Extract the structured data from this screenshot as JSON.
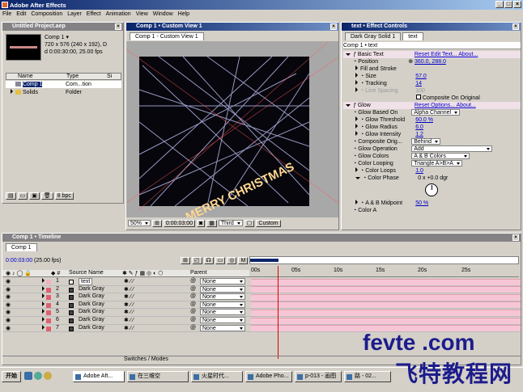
{
  "app": {
    "title": "Adobe After Effects"
  },
  "menu": [
    "File",
    "Edit",
    "Composition",
    "Layer",
    "Effect",
    "Animation",
    "View",
    "Window",
    "Help"
  ],
  "project": {
    "title": "Untitled Project.aep",
    "comp_name": "Comp 1 ▾",
    "info1": "720 x 576  (240 x 192), D",
    "info2": "d 0:00:30:00, 25.00 fps",
    "columns": [
      "Name",
      "Type",
      "Si"
    ],
    "items": [
      {
        "name": "Comp 1",
        "type": "Com...tion"
      },
      {
        "name": "Solids",
        "type": "Folder"
      }
    ],
    "bpc": "8 bpc"
  },
  "viewer": {
    "title": "Comp 1 • Custom View 1",
    "tab": "Comp 1 - Custom View 1",
    "text_layer": "MERRY CHRISTMAS",
    "zoom": "50%",
    "timecode": "0:00:03:00",
    "quality": "Third",
    "view": "Custom"
  },
  "effects": {
    "title": "text • Effect Controls",
    "tabs": [
      "Dark Gray Solid 1",
      "text"
    ],
    "header": "Comp 1 • text",
    "rows": [
      {
        "label": "Basic Text",
        "extra": "Reset  Edit Text...  About..."
      },
      {
        "label": "Position",
        "value": "360.0, 288.0"
      },
      {
        "label": "Fill and Stroke",
        "value": ""
      },
      {
        "label": "Size",
        "value": "57.0"
      },
      {
        "label": "Tracking",
        "value": "14"
      },
      {
        "label": "Line Spacing",
        "value": "100"
      },
      {
        "label": "",
        "value": "Composite On Original"
      },
      {
        "label": "Glow",
        "extra": "Reset  Options...  About..."
      },
      {
        "label": "Glow Based On",
        "value": "Alpha Channel"
      },
      {
        "label": "Glow Threshold",
        "value": "60.0 %"
      },
      {
        "label": "Glow Radius",
        "value": "6.0"
      },
      {
        "label": "Glow Intensity",
        "value": "1.2"
      },
      {
        "label": "Composite Orig...",
        "value": "Behind"
      },
      {
        "label": "Glow Operation",
        "value": "Add"
      },
      {
        "label": "Glow Colors",
        "value": "A & B Colors"
      },
      {
        "label": "Color Looping",
        "value": "Triangle A>B>A"
      },
      {
        "label": "Color Loops",
        "value": "1.0"
      },
      {
        "label": "Color Phase",
        "value": "0 x +0.0 dgr"
      },
      {
        "label": "A & B Midpoint",
        "value": "50 %"
      },
      {
        "label": "Color A",
        "value": ""
      }
    ]
  },
  "timeline": {
    "title": "Comp 1 • Timeline",
    "tab": "Comp 1",
    "timecode": "0:00:03:00",
    "fps": "(25.00 fps)",
    "col_source": "Source Name",
    "col_parent": "Parent",
    "ruler": [
      "00s",
      "05s",
      "10s",
      "15s",
      "20s",
      "25s"
    ],
    "layers": [
      {
        "num": "1",
        "name": "text",
        "parent": "None"
      },
      {
        "num": "2",
        "name": "Dark Gray",
        "parent": "None"
      },
      {
        "num": "3",
        "name": "Dark Gray",
        "parent": "None"
      },
      {
        "num": "4",
        "name": "Dark Gray",
        "parent": "None"
      },
      {
        "num": "5",
        "name": "Dark Gray",
        "parent": "None"
      },
      {
        "num": "6",
        "name": "Dark Gray",
        "parent": "None"
      },
      {
        "num": "7",
        "name": "Dark Gray",
        "parent": "None"
      }
    ],
    "switches": "Switches / Modes"
  },
  "watermark": {
    "site": "fevte .com",
    "cn": "飞特教程网"
  },
  "taskbar": {
    "start": "开始",
    "items": [
      "Adobe Aft...",
      "在三维空",
      "火星时代...",
      "Adobe Pho...",
      "p-013 - 画图",
      "路 - 02..."
    ]
  },
  "colors": {
    "titlebar": "#0a246a",
    "panel": "#d4d0c8",
    "layer_bar": "#f7c6d6",
    "value": "#0000c8",
    "watermark": "#1c1c8c"
  }
}
